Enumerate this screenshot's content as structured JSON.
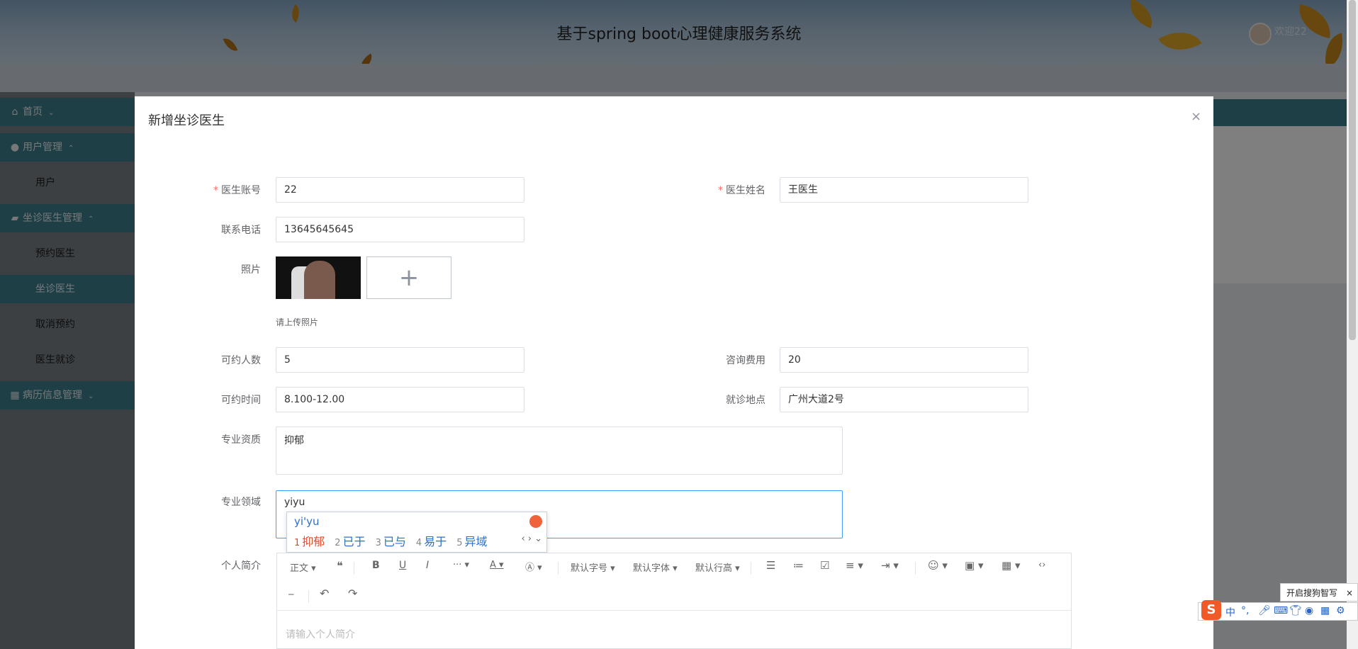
{
  "header": {
    "title": "基于spring boot心理健康服务系统",
    "welcome": "欢迎22"
  },
  "sidebar": {
    "items": [
      {
        "label": "首页",
        "type": "top",
        "icon": "home-icon",
        "chevron": "⌄"
      },
      {
        "label": "用户管理",
        "type": "top",
        "icon": "user-icon",
        "chevron": "⌃"
      },
      {
        "label": "用户",
        "type": "sub"
      },
      {
        "label": "坐诊医生管理",
        "type": "top",
        "icon": "briefcase-icon",
        "chevron": "⌃"
      },
      {
        "label": "预约医生",
        "type": "sub"
      },
      {
        "label": "坐诊医生",
        "type": "sub",
        "active": true
      },
      {
        "label": "取消预约",
        "type": "sub"
      },
      {
        "label": "医生就诊",
        "type": "sub"
      },
      {
        "label": "病历信息管理",
        "type": "top",
        "icon": "grid-icon",
        "chevron": "⌄"
      }
    ]
  },
  "dialog": {
    "title": "新增坐诊医生",
    "close": "×",
    "fields": {
      "account": {
        "label": "医生账号",
        "value": "22",
        "required": true
      },
      "name": {
        "label": "医生姓名",
        "value": "王医生",
        "required": true
      },
      "phone": {
        "label": "联系电话",
        "value": "13645645645"
      },
      "photo": {
        "label": "照片",
        "hint": "请上传照片",
        "add": "+"
      },
      "capacity": {
        "label": "可约人数",
        "value": "5"
      },
      "fee": {
        "label": "咨询费用",
        "value": "20"
      },
      "time": {
        "label": "可约时间",
        "value": "8.100-12.00"
      },
      "location": {
        "label": "就诊地点",
        "value": "广州大道2号"
      },
      "qualification": {
        "label": "专业资质",
        "value": "抑郁"
      },
      "field": {
        "label": "专业领域",
        "value": "yiyu"
      },
      "intro": {
        "label": "个人简介",
        "placeholder": "请输入个人简介"
      }
    }
  },
  "ime": {
    "pinyin": "yi'yu",
    "candidates": [
      {
        "n": "1",
        "text": "抑郁"
      },
      {
        "n": "2",
        "text": "已于"
      },
      {
        "n": "3",
        "text": "已与"
      },
      {
        "n": "4",
        "text": "易于"
      },
      {
        "n": "5",
        "text": "异域"
      }
    ],
    "nav": "‹ › ⌄"
  },
  "editor": {
    "toolbar": {
      "paragraph": "正文",
      "font_size": "默认字号",
      "font_family": "默认字体",
      "line_height": "默认行高"
    }
  },
  "sogou": {
    "tip": "开启搜狗智写",
    "tip_close": "×",
    "lang": "中"
  },
  "colors": {
    "accent": "#3d7f8b",
    "focus": "#409eff",
    "required": "#f56c6c"
  }
}
